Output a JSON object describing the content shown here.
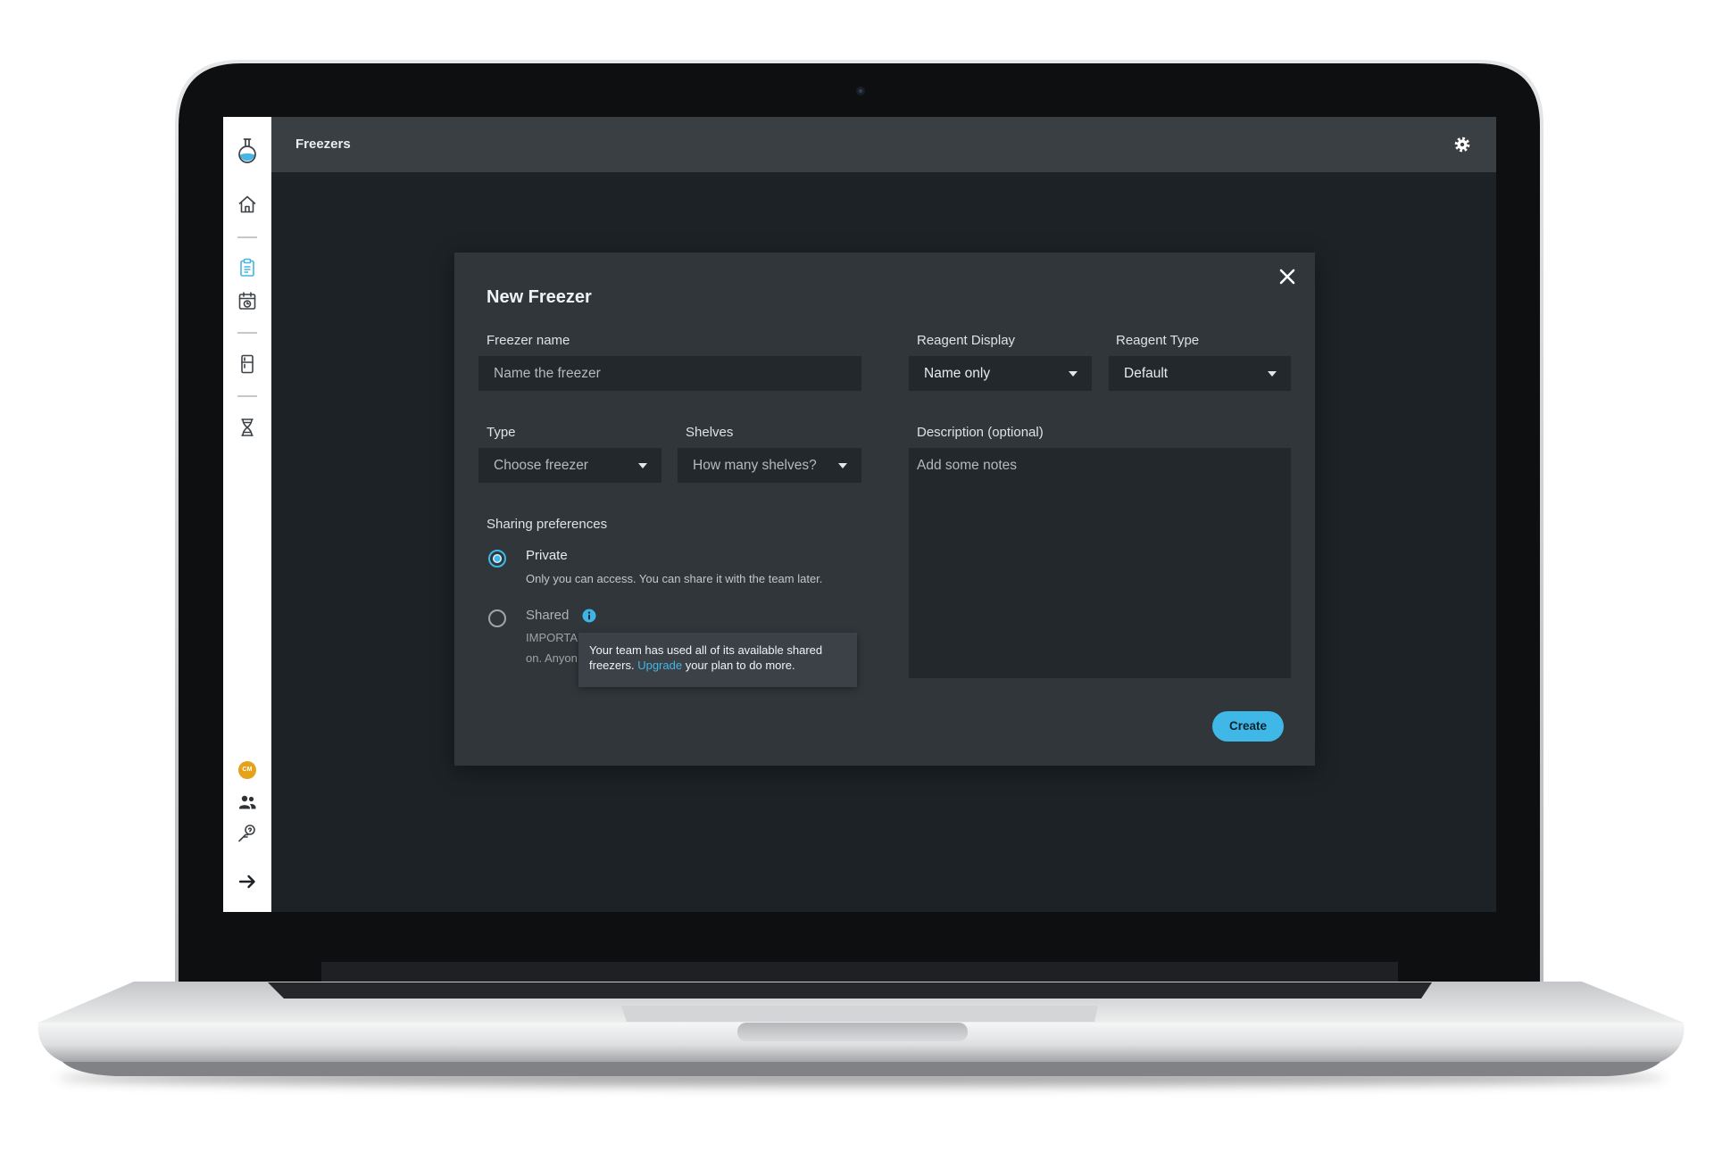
{
  "header": {
    "title": "Freezers",
    "settings_icon": "gear-icon"
  },
  "sidebar": {
    "logo_icon": "flask-logo-icon",
    "nav": [
      {
        "icon": "home-icon",
        "active": false
      },
      {
        "icon": "clipboard-icon",
        "active": true
      },
      {
        "icon": "calendar-icon",
        "active": false
      },
      {
        "icon": "freezer-icon",
        "active": false
      },
      {
        "icon": "dna-icon",
        "active": false
      }
    ],
    "avatar_initials": "CM",
    "footer": [
      {
        "icon": "team-icon"
      },
      {
        "icon": "support-icon"
      },
      {
        "icon": "arrow-right-icon"
      }
    ]
  },
  "modal": {
    "title": "New Freezer",
    "close_icon": "close-icon",
    "freezer_name": {
      "label": "Freezer name",
      "placeholder": "Name the freezer"
    },
    "reagent_display": {
      "label": "Reagent Display",
      "value": "Name only"
    },
    "reagent_type": {
      "label": "Reagent Type",
      "value": "Default"
    },
    "type": {
      "label": "Type",
      "value": "Choose freezer"
    },
    "shelves": {
      "label": "Shelves",
      "value": "How many shelves?"
    },
    "description": {
      "label": "Description (optional)",
      "placeholder": "Add some notes"
    },
    "sharing": {
      "label": "Sharing preferences",
      "options": [
        {
          "label": "Private",
          "selected": true,
          "description_lines": [
            "Only you can access. You can share it with the team later."
          ]
        },
        {
          "label": "Shared",
          "selected": false,
          "info_icon": "info-icon",
          "description_lines": [
            "IMPORTA",
            "on. Anyon"
          ]
        }
      ]
    },
    "tooltip": {
      "text": "Your team has used all of its available shared freezers.",
      "link": "Upgrade",
      "text_after": "your plan to do more."
    },
    "create_label": "Create"
  },
  "colors": {
    "accent": "#3fb8e8",
    "screen_background": "#1c2225",
    "header_background": "#3a3f44",
    "modal_background": "#30363a",
    "field_background": "#22282b",
    "sidebar_background": "#ffffff",
    "avatar": "#e6a11b"
  }
}
